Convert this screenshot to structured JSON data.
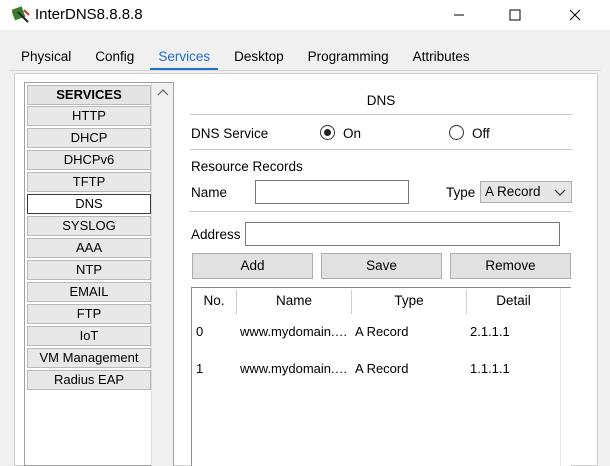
{
  "window": {
    "title": "InterDNS8.8.8.8",
    "minimize_glyph": "—",
    "maximize_glyph": "☐",
    "close_glyph": "✕"
  },
  "tabs": [
    {
      "label": "Physical"
    },
    {
      "label": "Config"
    },
    {
      "label": "Services",
      "active": true
    },
    {
      "label": "Desktop"
    },
    {
      "label": "Programming"
    },
    {
      "label": "Attributes"
    }
  ],
  "services": {
    "header": "SERVICES",
    "items": [
      "HTTP",
      "DHCP",
      "DHCPv6",
      "TFTP",
      "DNS",
      "SYSLOG",
      "AAA",
      "NTP",
      "EMAIL",
      "FTP",
      "IoT",
      "VM Management",
      "Radius EAP"
    ],
    "selected": "DNS"
  },
  "dns": {
    "title": "DNS",
    "service_label": "DNS Service",
    "on_label": "On",
    "off_label": "Off",
    "service_state": "On",
    "resource_records_label": "Resource Records",
    "name_label": "Name",
    "name_value": "",
    "type_label": "Type",
    "type_value": "A Record",
    "address_label": "Address",
    "address_value": "",
    "buttons": {
      "add": "Add",
      "save": "Save",
      "remove": "Remove"
    },
    "table": {
      "headers": [
        "No.",
        "Name",
        "Type",
        "Detail"
      ],
      "rows": [
        {
          "no": "0",
          "name": "www.mydomain.…",
          "type": "A Record",
          "detail": "2.1.1.1"
        },
        {
          "no": "1",
          "name": "www.mydomain.…",
          "type": "A Record",
          "detail": "1.1.1.1"
        }
      ]
    }
  },
  "colors": {
    "accent": "#1f6fd0",
    "panel_bg": "#f0f0f0"
  }
}
